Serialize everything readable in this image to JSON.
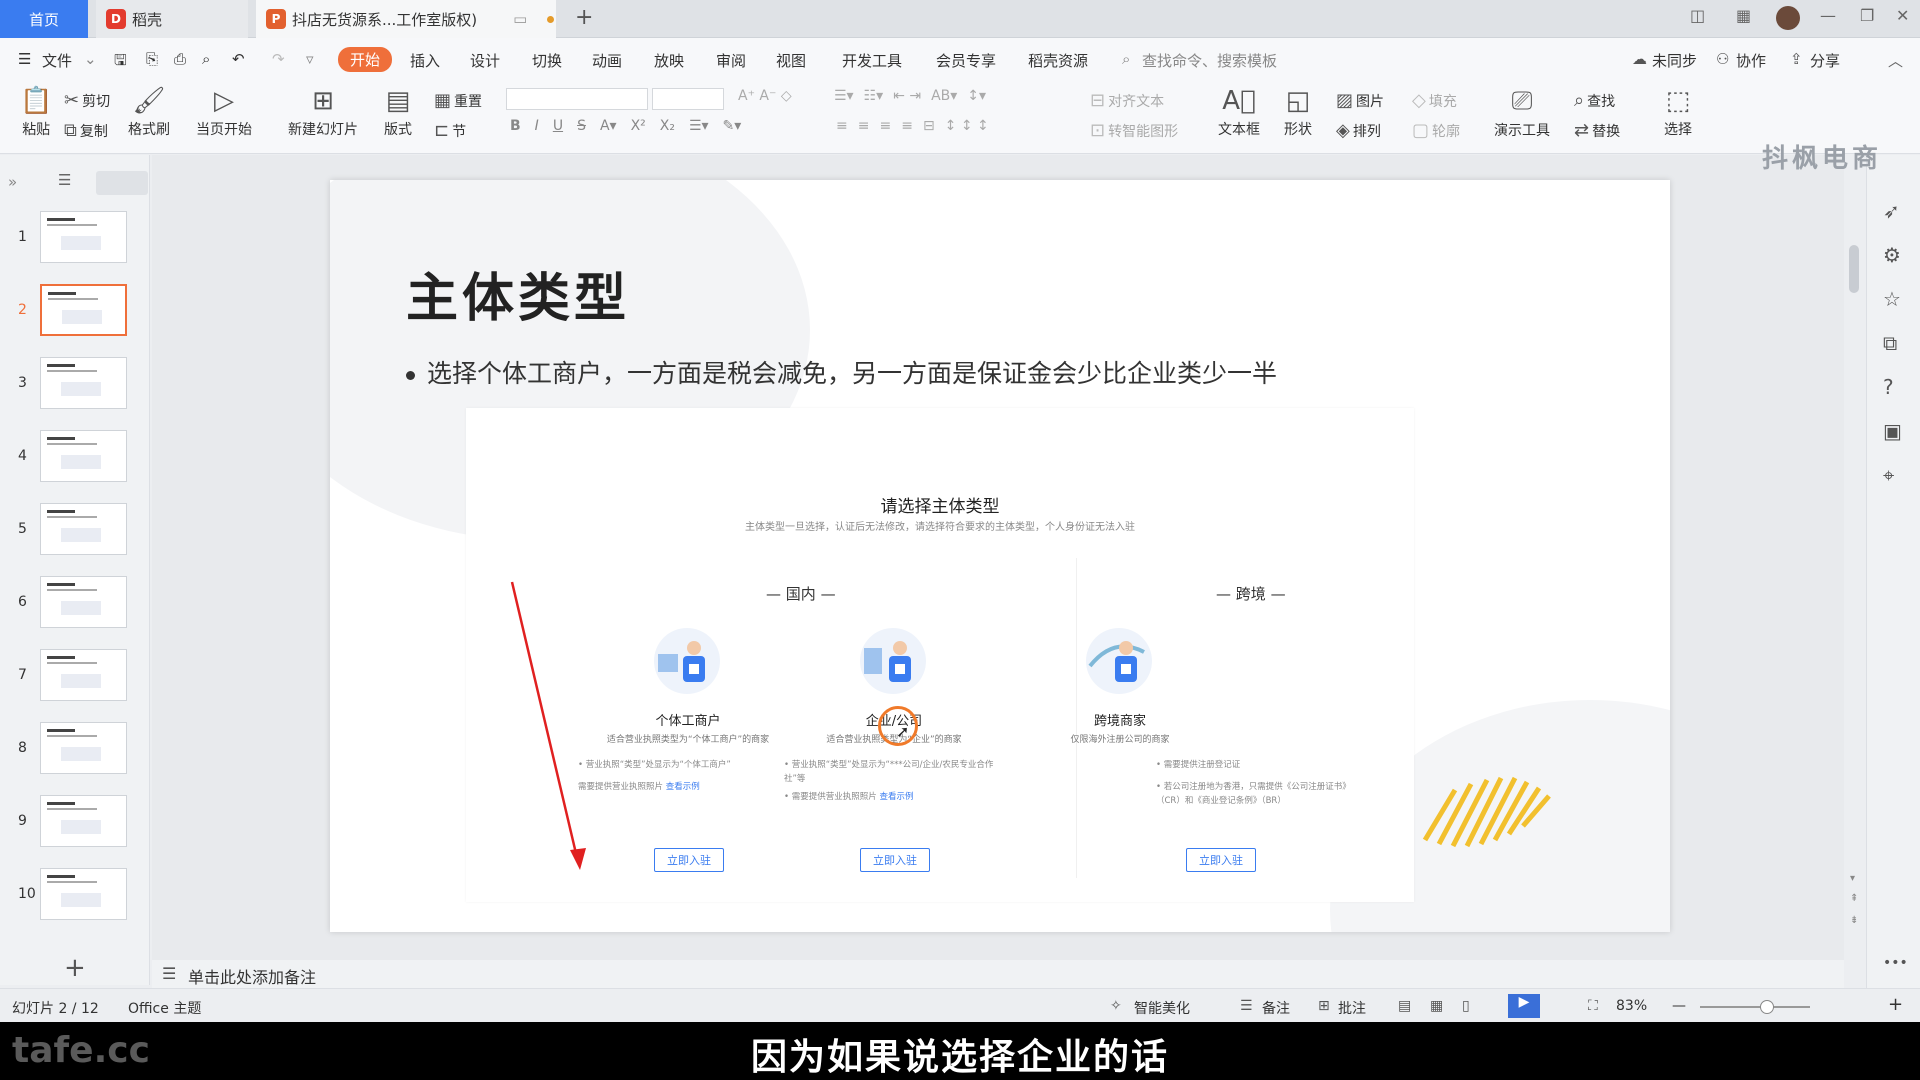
{
  "tabs": {
    "home": "首页",
    "daoke": "稻壳",
    "doc": "抖店无货源系...工作室版权)"
  },
  "menu": {
    "file": "文件",
    "items": [
      "开始",
      "插入",
      "设计",
      "切换",
      "动画",
      "放映",
      "审阅",
      "视图",
      "开发工具",
      "会员专享",
      "稻壳资源"
    ],
    "search_placeholder": "查找命令、搜索模板",
    "sync": "未同步",
    "collab": "协作",
    "share": "分享"
  },
  "toolbar": {
    "paste": "粘贴",
    "cut": "剪切",
    "copy": "复制",
    "format_painter": "格式刷",
    "from_current": "当页开始",
    "new_slide": "新建幻灯片",
    "layout": "版式",
    "reset": "重置",
    "section": "节",
    "align_text": "对齐文本",
    "smart_art": "转智能图形",
    "textbox": "文本框",
    "shape": "形状",
    "picture": "图片",
    "arrange": "排列",
    "fill": "填充",
    "outline": "轮廓",
    "presenter": "演示工具",
    "find": "查找",
    "replace": "替换",
    "select": "选择",
    "bold": "B",
    "italic": "I",
    "underline": "U",
    "strike": "S"
  },
  "slides": {
    "numbers": [
      "1",
      "2",
      "3",
      "4",
      "5",
      "6",
      "7",
      "8",
      "9",
      "10"
    ],
    "active": "2"
  },
  "slide": {
    "title": "主体类型",
    "bullet": "选择个体工商户，一方面是税会减免，另一方面是保证金会少比企业类少一半",
    "shot": {
      "heading": "请选择主体类型",
      "sub": "主体类型一旦选择，认证后无法修改，请选择符合要求的主体类型，个人身份证无法入驻",
      "domestic": "国内",
      "crossborder": "跨境",
      "cards": [
        {
          "title": "个体工商户",
          "desc": "适合营业执照类型为“个体工商户”的商家",
          "b1": "营业执照“类型”处显示为“个体工商户”",
          "b2": "需要提供营业执照照片",
          "link": "查看示例",
          "btn": "立即入驻"
        },
        {
          "title": "企业/公司",
          "desc": "适合营业执照类型为“企业”的商家",
          "b1": "营业执照“类型”处显示为“***公司/企业/农民专业合作社”等",
          "b2": "需要提供营业执照照片",
          "link": "查看示例",
          "btn": "立即入驻"
        },
        {
          "title": "跨境商家",
          "desc": "仅限海外注册公司的商家",
          "b1": "需要提供注册登记证",
          "b2": "若公司注册地为香港，只需提供《公司注册证书》（CR）和《商业登记条例》（BR）",
          "link": "",
          "btn": "立即入驻"
        }
      ]
    }
  },
  "notes_placeholder": "单击此处添加备注",
  "status": {
    "slide_pos": "幻灯片 2 / 12",
    "theme": "Office 主题",
    "beautify": "智能美化",
    "notes": "备注",
    "comments": "批注",
    "zoom": "83%"
  },
  "subtitle": "因为如果说选择企业的话",
  "watermark_left": "tafe.cc",
  "watermark_right": "抖枫电商",
  "colors": {
    "accent": "#ef6f3a",
    "home_tab": "#3a7cf0",
    "link": "#3a7cf0",
    "arrow": "#e02020"
  }
}
